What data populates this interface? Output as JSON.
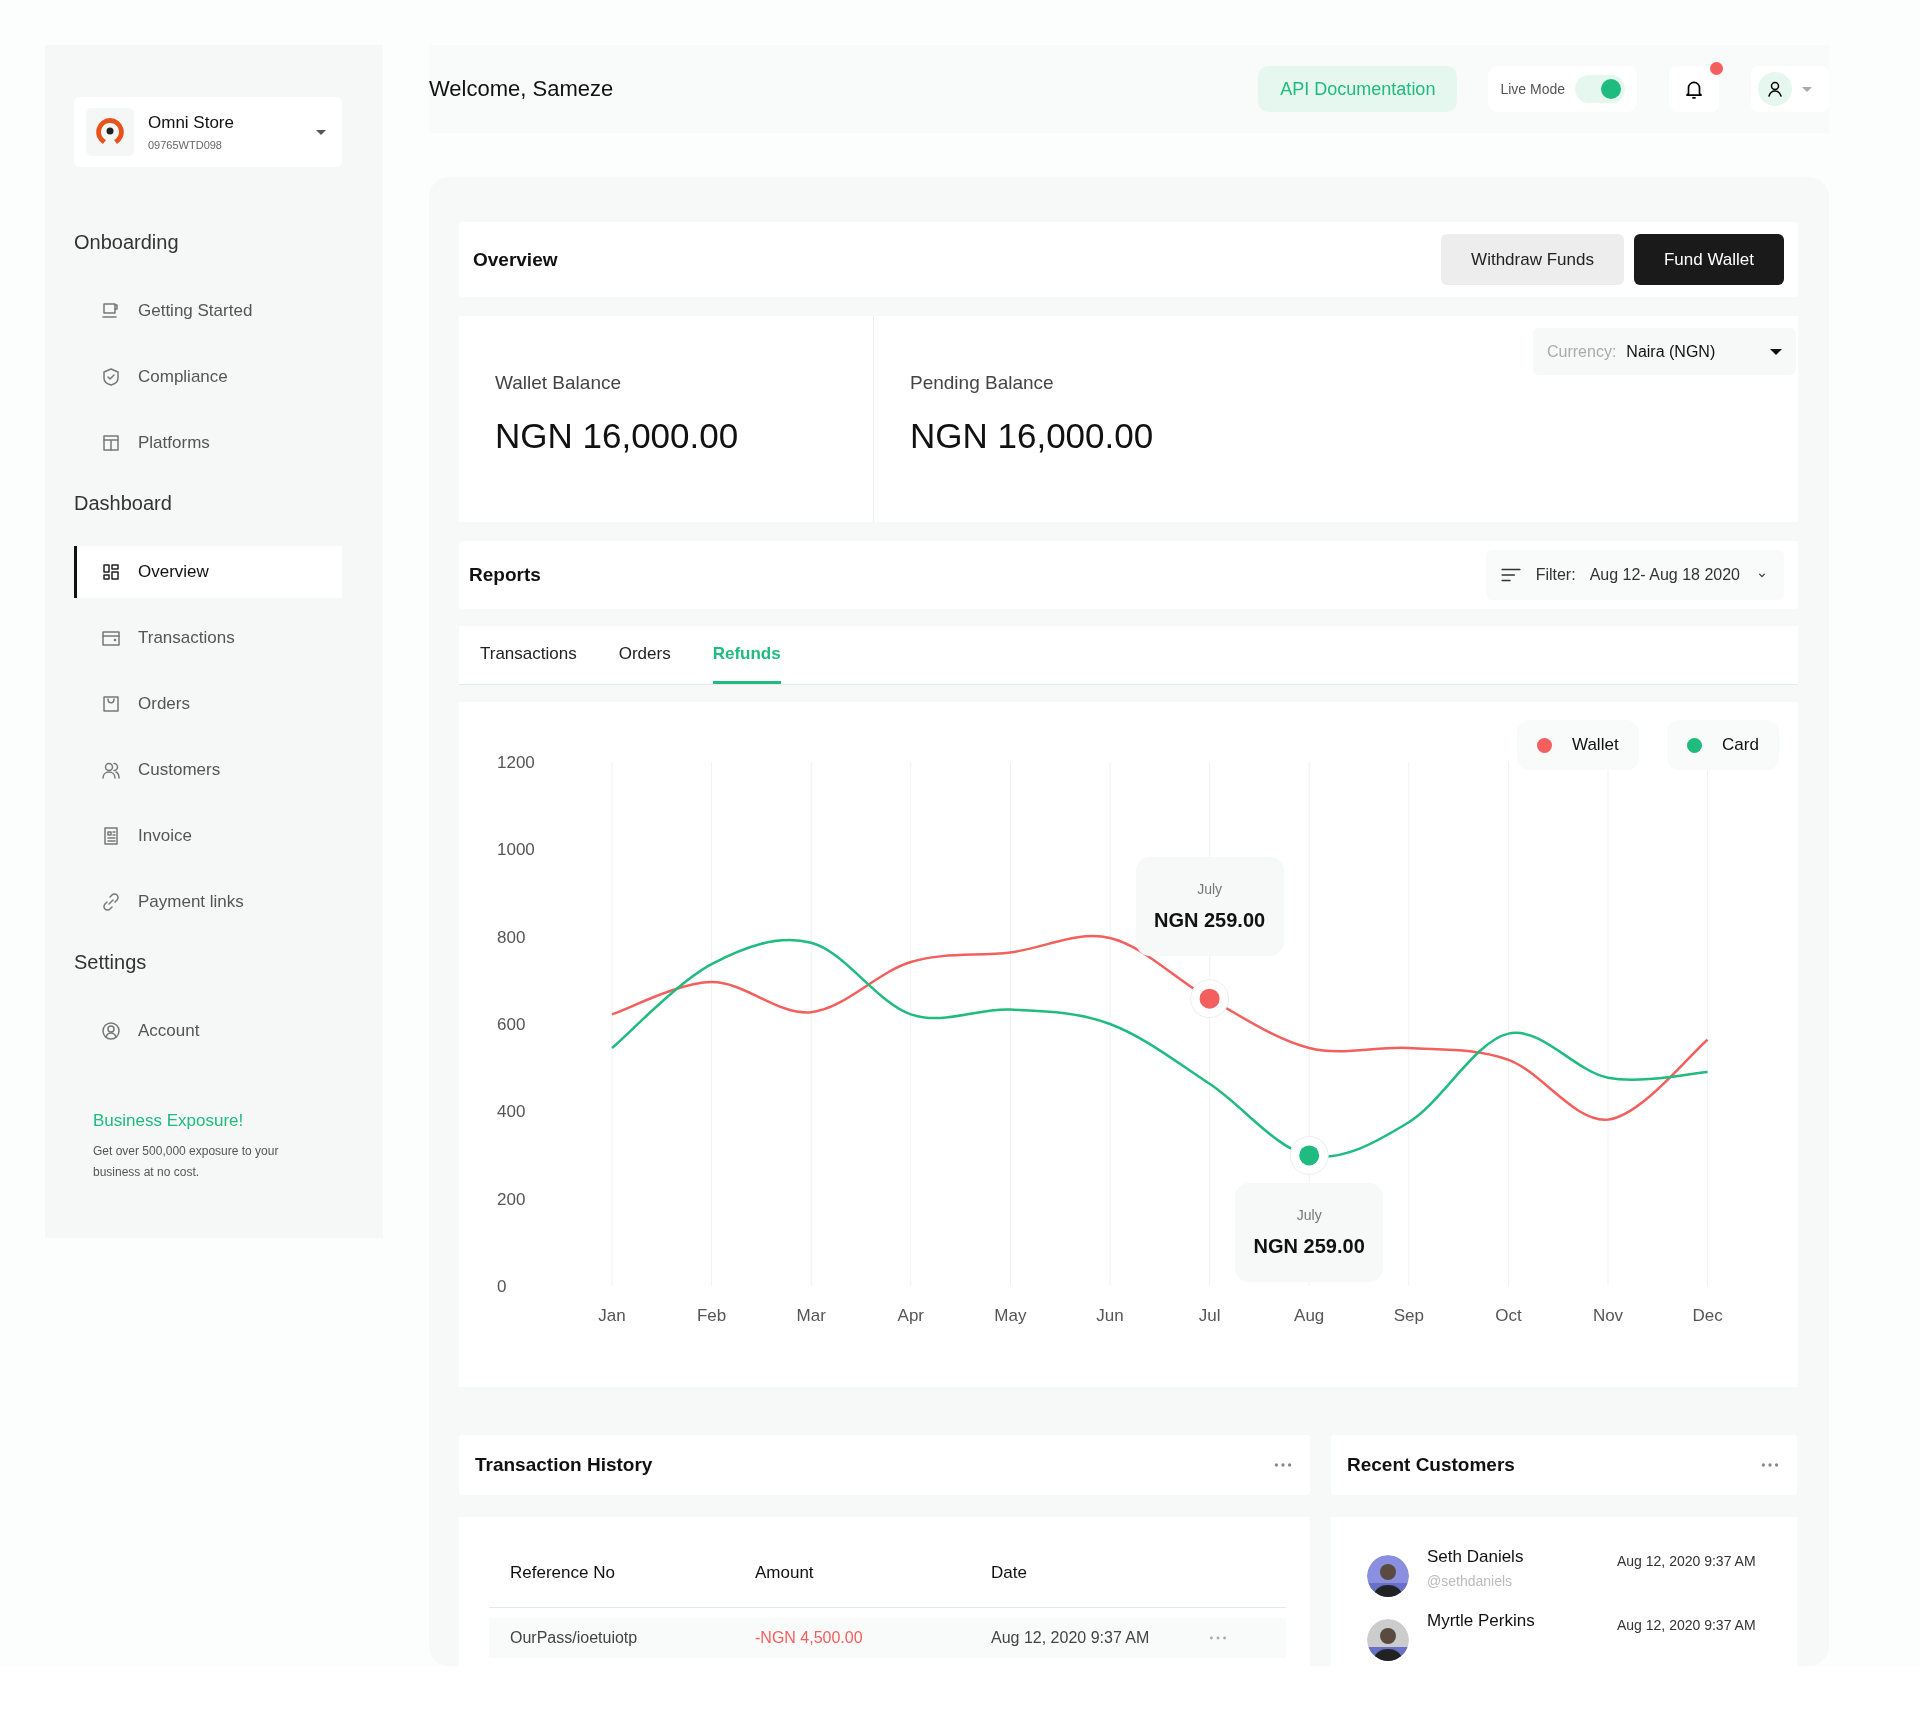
{
  "store": {
    "name": "Omni Store",
    "id": "09765WTD098"
  },
  "sidebar": {
    "sections": [
      {
        "title": "Onboarding",
        "items": [
          {
            "label": "Getting  Started",
            "selected": false
          },
          {
            "label": "Compliance",
            "selected": false
          },
          {
            "label": "Platforms",
            "selected": false
          }
        ]
      },
      {
        "title": "Dashboard",
        "items": [
          {
            "label": "Overview",
            "selected": true
          },
          {
            "label": "Transactions",
            "selected": false
          },
          {
            "label": "Orders",
            "selected": false
          },
          {
            "label": "Customers",
            "selected": false
          },
          {
            "label": "Invoice",
            "selected": false
          },
          {
            "label": "Payment links",
            "selected": false
          }
        ]
      },
      {
        "title": "Settings",
        "items": [
          {
            "label": "Account",
            "selected": false
          }
        ]
      }
    ]
  },
  "promo": {
    "title": "Business Exposure!",
    "text": "Get over 500,000 exposure to your business at no cost."
  },
  "header": {
    "greeting": "Welcome, Sameze",
    "api_button": "API Documentation",
    "live_mode": {
      "label": "Live Mode",
      "on": true
    },
    "notifications": {
      "unread": true
    }
  },
  "overview": {
    "title": "Overview",
    "buttons": [
      {
        "label": "Withdraw Funds",
        "kind": "secondary"
      },
      {
        "label": "Fund Wallet",
        "kind": "primary"
      }
    ]
  },
  "balances": [
    {
      "label": "Wallet Balance",
      "value": "NGN 16,000.00"
    },
    {
      "label": "Pending Balance",
      "value": "NGN 16,000.00"
    }
  ],
  "currency": {
    "label": "Currency:",
    "value": "Naira  (NGN)"
  },
  "reports": {
    "title": "Reports",
    "filter_label": "Filter:",
    "filter_value": "Aug 12- Aug 18 2020",
    "tabs": [
      {
        "label": "Transactions",
        "selected": false
      },
      {
        "label": "Orders",
        "selected": false
      },
      {
        "label": "Refunds",
        "selected": true
      }
    ],
    "chart_data": {
      "type": "line",
      "categories": [
        "Jan",
        "Feb",
        "Mar",
        "Apr",
        "May",
        "Jun",
        "Jul",
        "Aug",
        "Sep",
        "Oct",
        "Nov",
        "Dec"
      ],
      "series": [
        {
          "name": "Wallet",
          "color": "#f25f5c",
          "values": [
            622,
            696,
            627,
            742,
            764,
            797,
            658,
            545,
            545,
            518,
            381,
            564
          ]
        },
        {
          "name": "Card",
          "color": "#1fbb7f",
          "values": [
            545,
            737,
            786,
            622,
            633,
            600,
            463,
            299,
            375,
            578,
            477,
            490
          ]
        }
      ],
      "ylim": [
        0,
        1200
      ],
      "yticks": [
        0,
        200,
        400,
        600,
        800,
        1000,
        1200
      ],
      "grid": true,
      "legend": "upper right"
    },
    "tooltips": [
      {
        "month": "July",
        "value": "NGN 259.00"
      },
      {
        "month": "July",
        "value": "NGN 259.00"
      }
    ]
  },
  "transaction_history": {
    "title": "Transaction History",
    "columns": [
      "Reference No",
      "Amount",
      "Date"
    ],
    "rows": [
      {
        "reference": "OurPass/ioetuiotp",
        "amount": "-NGN 4,500.00",
        "date": "Aug 12, 2020 9:37 AM"
      }
    ]
  },
  "recent_customers": {
    "title": "Recent Customers",
    "customers": [
      {
        "name": "Seth Daniels",
        "handle": "@sethdaniels",
        "date": "Aug 12, 2020 9:37 AM"
      },
      {
        "name": "Myrtle Perkins",
        "date": "Aug 12, 2020 9:37 AM"
      }
    ]
  }
}
